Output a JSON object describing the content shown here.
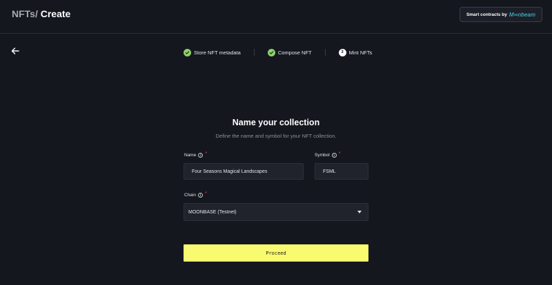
{
  "header": {
    "breadcrumb_parent": "NFTs/",
    "breadcrumb_current": "Create",
    "badge_text": "Smart contracts by",
    "badge_brand": "M∞nbeam"
  },
  "steps": [
    {
      "label": "Store NFT metadata",
      "status": "done"
    },
    {
      "label": "Compose NFT",
      "status": "done"
    },
    {
      "label": "Mint NFTs",
      "status": "current",
      "number": "3"
    }
  ],
  "form": {
    "title": "Name your collection",
    "subtitle": "Define the name and symbol for your NFT collection.",
    "name_label": "Name",
    "name_value": "Four Seasons Magical Landscapes",
    "symbol_label": "Symbol",
    "symbol_value": "FSML",
    "chain_label": "Chain",
    "chain_value": "MOONBASE (Testnet)",
    "required_mark": "*",
    "info_glyph": "i",
    "proceed_label": "Proceed"
  },
  "colors": {
    "background": "#15171f",
    "accent": "#f8fa6f",
    "step_done": "#8fd16a",
    "required": "#e35050",
    "brand": "#4fd4e6"
  }
}
